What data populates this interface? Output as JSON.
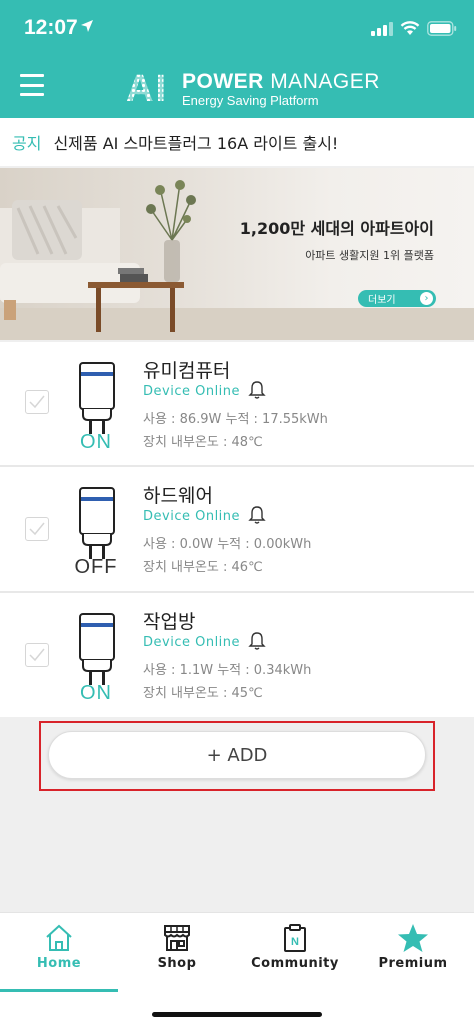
{
  "status_bar": {
    "time": "12:07"
  },
  "header": {
    "logo_ai": "AI",
    "logo_power": "POWER",
    "logo_manager": "MANAGER",
    "logo_subtitle": "Energy Saving Platform"
  },
  "notice": {
    "tag": "공지",
    "text": "신제품 AI 스마트플러그 16A 라이트 출시!"
  },
  "banner": {
    "title": "1,200만 세대의 아파트아이",
    "subtitle": "아파트 생활지원 1위 플랫폼",
    "more_label": "더보기",
    "more_chevron": "›"
  },
  "devices": [
    {
      "name": "유미컴퓨터",
      "online": "Device Online",
      "usage": "사용 : 86.9W   누적 : 17.55kWh",
      "temp": "장치 내부온도 : 48℃",
      "state": "ON"
    },
    {
      "name": "하드웨어",
      "online": "Device Online",
      "usage": "사용 : 0.0W   누적 : 0.00kWh",
      "temp": "장치 내부온도 : 46℃",
      "state": "OFF"
    },
    {
      "name": "작업방",
      "online": "Device Online",
      "usage": "사용 : 1.1W   누적 : 0.34kWh",
      "temp": "장치 내부온도 : 45℃",
      "state": "ON"
    }
  ],
  "add_button": {
    "label": "+ ADD"
  },
  "tabbar": {
    "tabs": [
      {
        "label": "Home",
        "icon": "home-icon",
        "active": true
      },
      {
        "label": "Shop",
        "icon": "shop-icon",
        "active": false
      },
      {
        "label": "Community",
        "icon": "community-icon",
        "active": false
      },
      {
        "label": "Premium",
        "icon": "star-icon",
        "active": false
      }
    ]
  },
  "colors": {
    "accent": "#35bdb3",
    "plug_band": "#2f5fb0",
    "highlight": "#d8232a"
  }
}
